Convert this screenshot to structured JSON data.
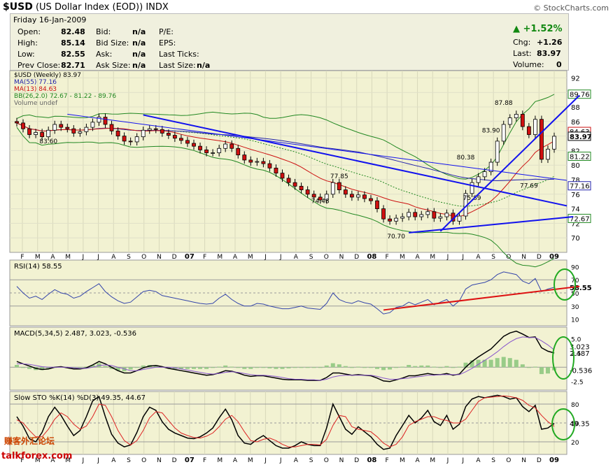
{
  "header": {
    "symbol": "$USD",
    "name": "(US Dollar Index (EOD))",
    "exchange": "INDX",
    "source": "© StockCharts.com"
  },
  "quote": {
    "date": "Friday  16-Jan-2009",
    "open_label": "Open:",
    "open": "82.48",
    "high_label": "High:",
    "high": "85.14",
    "low_label": "Low:",
    "low": "82.55",
    "prev_label": "Prev Close:",
    "prev": "82.71",
    "bid_label": "Bid:",
    "bid": "n/a",
    "bidsize_label": "Bid Size:",
    "bidsize": "n/a",
    "ask_label": "Ask:",
    "ask": "n/a",
    "asksize_label": "Ask Size:",
    "asksize": "n/a",
    "pe_label": "P/E:",
    "eps_label": "EPS:",
    "lastticks_label": "Last Ticks:",
    "lastsize_label": "Last Size:",
    "lastsize": "n/a",
    "pct_change": "▲ +1.52%",
    "chg_label": "Chg:",
    "chg": "+1.26",
    "last_label": "Last:",
    "last": "83.97",
    "volume_label": "Volume:",
    "volume": "0"
  },
  "colors": {
    "panel_bg": "#f2f2d2",
    "ma55": "#2222aa",
    "ma13": "#cc1111",
    "bb": "#228822",
    "trend_blue": "#1111ee",
    "trend_red": "#dd1111",
    "circle": "#22aa22"
  },
  "chart_data": [
    {
      "type": "candlestick",
      "legend": [
        "$USD (Weekly) 83.97",
        "MA(55) 77.16",
        "MA(13) 84.63",
        "BB(26,2.0) 72.67 - 81.22 - 89.76",
        "Volume undef"
      ],
      "ylim": [
        68,
        93
      ],
      "y_ticks": [
        "92",
        "90",
        "88",
        "86",
        "84",
        "82",
        "80",
        "78",
        "76",
        "74",
        "72",
        "70"
      ],
      "right_labels": [
        "89.76",
        "84.63",
        "83.97",
        "81.22",
        "77.16",
        "72.67"
      ],
      "annotations": [
        "83.60",
        "87.88",
        "83.90",
        "80.38",
        "77.85",
        "74.48",
        "75.89",
        "77.69",
        "70.70"
      ],
      "x_ticks": [
        "F",
        "M",
        "A",
        "M",
        "J",
        "J",
        "A",
        "S",
        "O",
        "N",
        "D",
        "07",
        "F",
        "M",
        "A",
        "M",
        "J",
        "J",
        "A",
        "S",
        "O",
        "N",
        "D",
        "08",
        "F",
        "M",
        "A",
        "M",
        "J",
        "J",
        "A",
        "S",
        "O",
        "N",
        "D",
        "09"
      ],
      "close": [
        85.8,
        85.0,
        84.2,
        84.5,
        83.9,
        84.8,
        85.6,
        85.2,
        85.0,
        84.4,
        84.6,
        85.2,
        85.9,
        86.6,
        85.6,
        84.7,
        84.0,
        83.3,
        83.2,
        83.9,
        84.8,
        85.0,
        84.9,
        84.4,
        84.1,
        83.7,
        83.4,
        83.0,
        82.6,
        82.1,
        81.7,
        81.7,
        82.3,
        82.9,
        82.3,
        81.4,
        80.7,
        80.4,
        80.5,
        80.2,
        79.6,
        78.9,
        78.2,
        77.6,
        77.1,
        76.6,
        76.0,
        75.6,
        75.2,
        76.0,
        77.6,
        76.6,
        76.0,
        75.6,
        75.9,
        75.4,
        75.1,
        74.0,
        72.6,
        72.3,
        72.7,
        72.9,
        73.5,
        72.9,
        73.2,
        73.6,
        72.7,
        72.9,
        73.4,
        72.3,
        73.0,
        76.1,
        77.6,
        78.4,
        79.1,
        80.4,
        83.3,
        85.6,
        86.5,
        87.0,
        85.3,
        84.2,
        86.3,
        80.8,
        82.2,
        83.97
      ]
    },
    {
      "type": "line",
      "legend": [
        "RSI(14) 58.55"
      ],
      "ylim": [
        0,
        100
      ],
      "y_ticks": [
        "90",
        "70",
        "50",
        "30",
        "10"
      ],
      "right_labels": [
        "58.55"
      ],
      "values": [
        60,
        50,
        42,
        45,
        40,
        48,
        55,
        50,
        48,
        42,
        45,
        52,
        58,
        64,
        52,
        44,
        38,
        34,
        36,
        44,
        52,
        54,
        52,
        46,
        44,
        42,
        40,
        38,
        36,
        34,
        33,
        34,
        42,
        48,
        40,
        34,
        30,
        30,
        34,
        33,
        30,
        28,
        26,
        26,
        28,
        30,
        27,
        26,
        25,
        34,
        50,
        40,
        36,
        34,
        38,
        35,
        33,
        26,
        18,
        20,
        28,
        30,
        36,
        32,
        36,
        40,
        32,
        36,
        40,
        30,
        38,
        56,
        62,
        64,
        66,
        70,
        78,
        82,
        80,
        78,
        68,
        64,
        72,
        52,
        56,
        58.55
      ]
    },
    {
      "type": "line",
      "legend": [
        "MACD(5,34,5) 2.487, 3.023, -0.536"
      ],
      "ylim": [
        -4,
        7
      ],
      "y_ticks": [
        "5.0",
        "2.5",
        "-2.5"
      ],
      "right_labels": [
        "3.023",
        "2.487",
        "-0.536"
      ],
      "series": [
        {
          "name": "MACD",
          "values": [
            1.0,
            0.6,
            0.2,
            -0.2,
            -0.4,
            -0.3,
            0.0,
            0.1,
            -0.1,
            -0.3,
            -0.3,
            -0.1,
            0.4,
            1.0,
            0.6,
            0.0,
            -0.6,
            -1.0,
            -1.0,
            -0.6,
            -0.1,
            0.2,
            0.3,
            0.1,
            -0.2,
            -0.4,
            -0.6,
            -0.8,
            -1.0,
            -1.2,
            -1.4,
            -1.3,
            -1.0,
            -0.6,
            -0.7,
            -1.0,
            -1.4,
            -1.6,
            -1.5,
            -1.5,
            -1.7,
            -1.9,
            -2.1,
            -2.2,
            -2.2,
            -2.2,
            -2.3,
            -2.3,
            -2.3,
            -1.8,
            -1.0,
            -1.0,
            -1.2,
            -1.4,
            -1.3,
            -1.4,
            -1.5,
            -1.9,
            -2.4,
            -2.5,
            -2.2,
            -1.9,
            -1.5,
            -1.5,
            -1.3,
            -1.1,
            -1.3,
            -1.3,
            -1.1,
            -1.4,
            -1.2,
            0.0,
            1.0,
            1.8,
            2.5,
            3.2,
            4.3,
            5.4,
            6.0,
            6.3,
            5.8,
            5.2,
            5.3,
            3.4,
            2.8,
            2.487
          ]
        },
        {
          "name": "Signal",
          "values": [
            0.6,
            0.6,
            0.5,
            0.3,
            0.1,
            0.0,
            0.0,
            0.0,
            0.0,
            -0.1,
            -0.2,
            -0.2,
            0.0,
            0.3,
            0.4,
            0.3,
            0.0,
            -0.3,
            -0.6,
            -0.6,
            -0.4,
            -0.2,
            0.0,
            0.0,
            0.0,
            -0.1,
            -0.3,
            -0.5,
            -0.7,
            -0.9,
            -1.1,
            -1.2,
            -1.1,
            -0.9,
            -0.8,
            -0.9,
            -1.1,
            -1.3,
            -1.4,
            -1.4,
            -1.5,
            -1.6,
            -1.8,
            -2.0,
            -2.1,
            -2.1,
            -2.2,
            -2.2,
            -2.3,
            -2.1,
            -1.7,
            -1.5,
            -1.4,
            -1.4,
            -1.4,
            -1.4,
            -1.4,
            -1.6,
            -1.9,
            -2.1,
            -2.1,
            -2.0,
            -1.9,
            -1.7,
            -1.6,
            -1.4,
            -1.4,
            -1.3,
            -1.3,
            -1.3,
            -1.3,
            -0.8,
            -0.2,
            0.5,
            1.2,
            1.9,
            2.7,
            3.6,
            4.4,
            5.0,
            5.3,
            5.2,
            5.2,
            4.6,
            3.9,
            3.023
          ]
        }
      ]
    },
    {
      "type": "line",
      "legend": [
        "Slow STO %K(14) %D(3) 49.35, 44.67"
      ],
      "ylim": [
        0,
        100
      ],
      "y_ticks": [
        "80",
        "50",
        "20"
      ],
      "right_labels": [
        "49.35"
      ],
      "series": [
        {
          "name": "%K",
          "values": [
            60,
            45,
            25,
            20,
            35,
            60,
            75,
            62,
            45,
            30,
            38,
            60,
            85,
            92,
            60,
            32,
            18,
            12,
            15,
            35,
            60,
            75,
            70,
            52,
            40,
            34,
            30,
            26,
            25,
            28,
            34,
            42,
            58,
            72,
            55,
            30,
            18,
            16,
            24,
            30,
            22,
            14,
            10,
            10,
            14,
            20,
            16,
            14,
            14,
            42,
            80,
            60,
            40,
            32,
            44,
            36,
            28,
            16,
            8,
            10,
            30,
            46,
            62,
            50,
            58,
            70,
            52,
            46,
            62,
            40,
            48,
            76,
            88,
            92,
            90,
            92,
            94,
            92,
            88,
            90,
            76,
            68,
            78,
            40,
            42,
            49.35
          ]
        },
        {
          "name": "%D",
          "values": [
            55,
            50,
            38,
            28,
            28,
            40,
            56,
            66,
            60,
            48,
            40,
            45,
            60,
            80,
            78,
            60,
            38,
            22,
            15,
            22,
            38,
            58,
            68,
            66,
            54,
            42,
            34,
            30,
            27,
            26,
            29,
            34,
            44,
            56,
            62,
            52,
            36,
            22,
            20,
            24,
            26,
            22,
            16,
            12,
            12,
            14,
            16,
            16,
            15,
            24,
            46,
            62,
            60,
            44,
            40,
            38,
            36,
            28,
            18,
            12,
            16,
            28,
            46,
            52,
            56,
            60,
            60,
            56,
            54,
            50,
            50,
            56,
            70,
            84,
            90,
            91,
            92,
            93,
            92,
            90,
            86,
            78,
            74,
            62,
            52,
            44.67
          ]
        }
      ]
    }
  ],
  "watermark": {
    "line1": "赚客外汇论坛",
    "line2": "talkforex.com"
  }
}
